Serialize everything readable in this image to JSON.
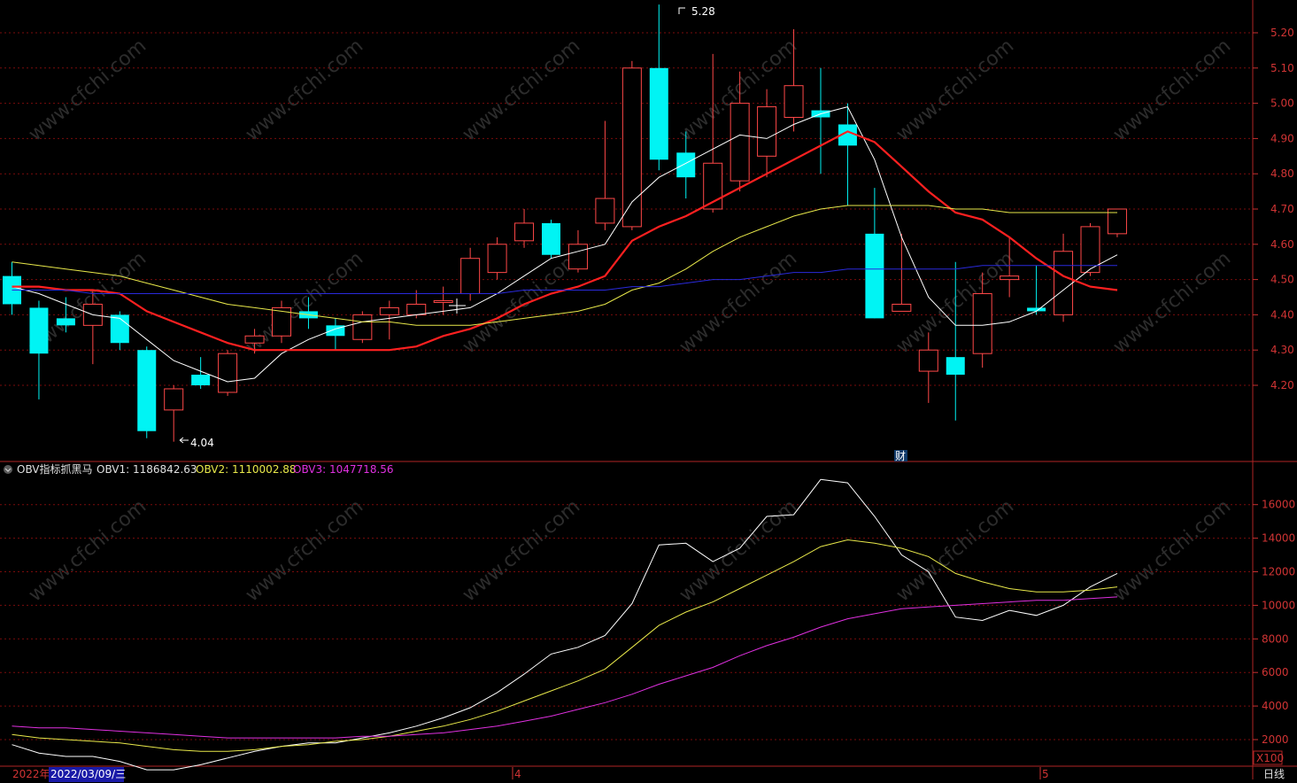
{
  "colors": {
    "up": "#ff4848",
    "down": "#00f4f4",
    "ma5": "#ffffff",
    "ma10": "#ff2020",
    "ma20": "#e8e84a",
    "ma60": "#2a2adc",
    "obv1": "#ffffff",
    "obv2": "#e8e84a",
    "obv3": "#e030e0",
    "axis": "#c83030",
    "grid": "#7a0c0c"
  },
  "watermark": "www.cfchi.com",
  "top_markers": {
    "high_label": "5.28",
    "low_label": "4.04",
    "badge": "财"
  },
  "obv_legend": {
    "name": "OBV指标抓黑马",
    "obv1_label": "OBV1: 1186842.63",
    "obv2_label": "OBV2: 1110002.88",
    "obv3_label": "OBV3: 1047718.56"
  },
  "bottom_bar": {
    "year": "2022年",
    "date": "2022/03/09/三",
    "month_4": "4",
    "month_5": "5",
    "multiplier": "X100",
    "period": "日线"
  },
  "chart_data": [
    {
      "type": "candlestick",
      "y_ticks": [
        4.2,
        4.3,
        4.4,
        4.5,
        4.6,
        4.7,
        4.8,
        4.9,
        5.0,
        5.1,
        5.2
      ],
      "ylim": [
        4.0,
        5.3
      ],
      "candles": [
        {
          "o": 4.51,
          "c": 4.43,
          "h": 4.55,
          "l": 4.4
        },
        {
          "o": 4.42,
          "c": 4.29,
          "h": 4.44,
          "l": 4.16
        },
        {
          "o": 4.39,
          "c": 4.37,
          "h": 4.45,
          "l": 4.35
        },
        {
          "o": 4.37,
          "c": 4.43,
          "h": 4.47,
          "l": 4.26
        },
        {
          "o": 4.4,
          "c": 4.32,
          "h": 4.41,
          "l": 4.3
        },
        {
          "o": 4.3,
          "c": 4.07,
          "h": 4.31,
          "l": 4.05
        },
        {
          "o": 4.13,
          "c": 4.19,
          "h": 4.2,
          "l": 4.04
        },
        {
          "o": 4.23,
          "c": 4.2,
          "h": 4.28,
          "l": 4.19
        },
        {
          "o": 4.18,
          "c": 4.29,
          "h": 4.3,
          "l": 4.17
        },
        {
          "o": 4.32,
          "c": 4.34,
          "h": 4.36,
          "l": 4.29
        },
        {
          "o": 4.34,
          "c": 4.42,
          "h": 4.44,
          "l": 4.32
        },
        {
          "o": 4.41,
          "c": 4.39,
          "h": 4.45,
          "l": 4.36
        },
        {
          "o": 4.37,
          "c": 4.34,
          "h": 4.39,
          "l": 4.3
        },
        {
          "o": 4.33,
          "c": 4.4,
          "h": 4.41,
          "l": 4.32
        },
        {
          "o": 4.4,
          "c": 4.42,
          "h": 4.44,
          "l": 4.33
        },
        {
          "o": 4.4,
          "c": 4.43,
          "h": 4.47,
          "l": 4.39
        },
        {
          "o": 4.44,
          "c": 4.44,
          "h": 4.48,
          "l": 4.4
        },
        {
          "o": 4.46,
          "c": 4.56,
          "h": 4.59,
          "l": 4.44
        },
        {
          "o": 4.52,
          "c": 4.6,
          "h": 4.62,
          "l": 4.5
        },
        {
          "o": 4.61,
          "c": 4.66,
          "h": 4.7,
          "l": 4.59
        },
        {
          "o": 4.66,
          "c": 4.57,
          "h": 4.67,
          "l": 4.56
        },
        {
          "o": 4.53,
          "c": 4.6,
          "h": 4.64,
          "l": 4.52
        },
        {
          "o": 4.66,
          "c": 4.73,
          "h": 4.95,
          "l": 4.64
        },
        {
          "o": 4.65,
          "c": 5.1,
          "h": 5.12,
          "l": 4.64
        },
        {
          "o": 5.1,
          "c": 4.84,
          "h": 5.28,
          "l": 4.81
        },
        {
          "o": 4.86,
          "c": 4.79,
          "h": 4.92,
          "l": 4.73
        },
        {
          "o": 4.7,
          "c": 4.83,
          "h": 5.14,
          "l": 4.69
        },
        {
          "o": 4.78,
          "c": 5.0,
          "h": 5.09,
          "l": 4.75
        },
        {
          "o": 4.85,
          "c": 4.99,
          "h": 5.04,
          "l": 4.79
        },
        {
          "o": 4.96,
          "c": 5.05,
          "h": 5.21,
          "l": 4.92
        },
        {
          "o": 4.98,
          "c": 4.96,
          "h": 5.1,
          "l": 4.8
        },
        {
          "o": 4.94,
          "c": 4.88,
          "h": 5.0,
          "l": 4.71
        },
        {
          "o": 4.63,
          "c": 4.39,
          "h": 4.76,
          "l": 4.39
        },
        {
          "o": 4.41,
          "c": 4.43,
          "h": 4.63,
          "l": 4.41
        },
        {
          "o": 4.24,
          "c": 4.3,
          "h": 4.35,
          "l": 4.15
        },
        {
          "o": 4.28,
          "c": 4.23,
          "h": 4.55,
          "l": 4.1
        },
        {
          "o": 4.29,
          "c": 4.46,
          "h": 4.52,
          "l": 4.25
        },
        {
          "o": 4.5,
          "c": 4.51,
          "h": 4.62,
          "l": 4.45
        },
        {
          "o": 4.42,
          "c": 4.41,
          "h": 4.54,
          "l": 4.4
        },
        {
          "o": 4.4,
          "c": 4.58,
          "h": 4.63,
          "l": 4.38
        },
        {
          "o": 4.52,
          "c": 4.65,
          "h": 4.66,
          "l": 4.51
        },
        {
          "o": 4.63,
          "c": 4.7,
          "h": 4.7,
          "l": 4.62
        }
      ],
      "series": [
        {
          "key": "ma5",
          "values": [
            4.48,
            4.46,
            4.43,
            4.4,
            4.39,
            4.33,
            4.27,
            4.24,
            4.21,
            4.22,
            4.29,
            4.33,
            4.36,
            4.38,
            4.39,
            4.4,
            4.41,
            4.42,
            4.46,
            4.51,
            4.56,
            4.58,
            4.6,
            4.72,
            4.79,
            4.83,
            4.87,
            4.91,
            4.9,
            4.94,
            4.97,
            4.99,
            4.84,
            4.62,
            4.45,
            4.37,
            4.37,
            4.38,
            4.41,
            4.47,
            4.53,
            4.57
          ]
        },
        {
          "key": "ma10",
          "values": [
            4.48,
            4.48,
            4.47,
            4.47,
            4.46,
            4.41,
            4.38,
            4.35,
            4.32,
            4.3,
            4.3,
            4.3,
            4.3,
            4.3,
            4.3,
            4.31,
            4.34,
            4.36,
            4.39,
            4.43,
            4.46,
            4.48,
            4.51,
            4.61,
            4.65,
            4.68,
            4.72,
            4.76,
            4.8,
            4.84,
            4.88,
            4.92,
            4.89,
            4.82,
            4.75,
            4.69,
            4.67,
            4.62,
            4.56,
            4.51,
            4.48,
            4.47
          ]
        },
        {
          "key": "ma20",
          "values": [
            4.55,
            4.54,
            4.53,
            4.52,
            4.51,
            4.49,
            4.47,
            4.45,
            4.43,
            4.42,
            4.41,
            4.4,
            4.39,
            4.38,
            4.38,
            4.37,
            4.37,
            4.37,
            4.38,
            4.39,
            4.4,
            4.41,
            4.43,
            4.47,
            4.49,
            4.53,
            4.58,
            4.62,
            4.65,
            4.68,
            4.7,
            4.71,
            4.71,
            4.71,
            4.71,
            4.7,
            4.7,
            4.69,
            4.69,
            4.69,
            4.69,
            4.69
          ]
        },
        {
          "key": "ma60",
          "values": [
            4.47,
            4.47,
            4.47,
            4.46,
            4.46,
            4.46,
            4.46,
            4.46,
            4.46,
            4.46,
            4.46,
            4.46,
            4.46,
            4.46,
            4.46,
            4.46,
            4.46,
            4.46,
            4.46,
            4.47,
            4.47,
            4.47,
            4.47,
            4.48,
            4.48,
            4.49,
            4.5,
            4.5,
            4.51,
            4.52,
            4.52,
            4.53,
            4.53,
            4.53,
            4.53,
            4.53,
            4.54,
            4.54,
            4.54,
            4.54,
            4.54,
            4.54
          ]
        }
      ]
    },
    {
      "type": "line",
      "y_ticks": [
        2000,
        4000,
        6000,
        8000,
        10000,
        12000,
        14000,
        16000
      ],
      "ylim": [
        0,
        17000
      ],
      "series": [
        {
          "key": "obv1",
          "values": [
            1700,
            1200,
            1000,
            1000,
            700,
            200,
            200,
            500,
            900,
            1300,
            1600,
            1800,
            1800,
            2100,
            2400,
            2800,
            3300,
            3900,
            4800,
            5900,
            7100,
            7500,
            8200,
            10100,
            13600,
            13700,
            12600,
            13400,
            15300,
            15400,
            17500,
            17300,
            15300,
            13000,
            12000,
            9300,
            9100,
            9700,
            9400,
            10000,
            11100,
            11900
          ]
        },
        {
          "key": "obv2",
          "values": [
            2300,
            2100,
            2000,
            1900,
            1800,
            1600,
            1400,
            1300,
            1300,
            1400,
            1600,
            1700,
            1900,
            2000,
            2200,
            2500,
            2800,
            3200,
            3700,
            4300,
            4900,
            5500,
            6200,
            7500,
            8800,
            9600,
            10200,
            11000,
            11800,
            12600,
            13500,
            13900,
            13700,
            13400,
            12900,
            11900,
            11400,
            11000,
            10800,
            10800,
            10900,
            11100
          ]
        },
        {
          "key": "obv3",
          "values": [
            2800,
            2700,
            2700,
            2600,
            2500,
            2400,
            2300,
            2200,
            2100,
            2100,
            2100,
            2100,
            2100,
            2200,
            2200,
            2300,
            2400,
            2600,
            2800,
            3100,
            3400,
            3800,
            4200,
            4700,
            5300,
            5800,
            6300,
            7000,
            7600,
            8100,
            8700,
            9200,
            9500,
            9800,
            9900,
            10000,
            10100,
            10200,
            10300,
            10300,
            10400,
            10500
          ]
        }
      ]
    }
  ]
}
